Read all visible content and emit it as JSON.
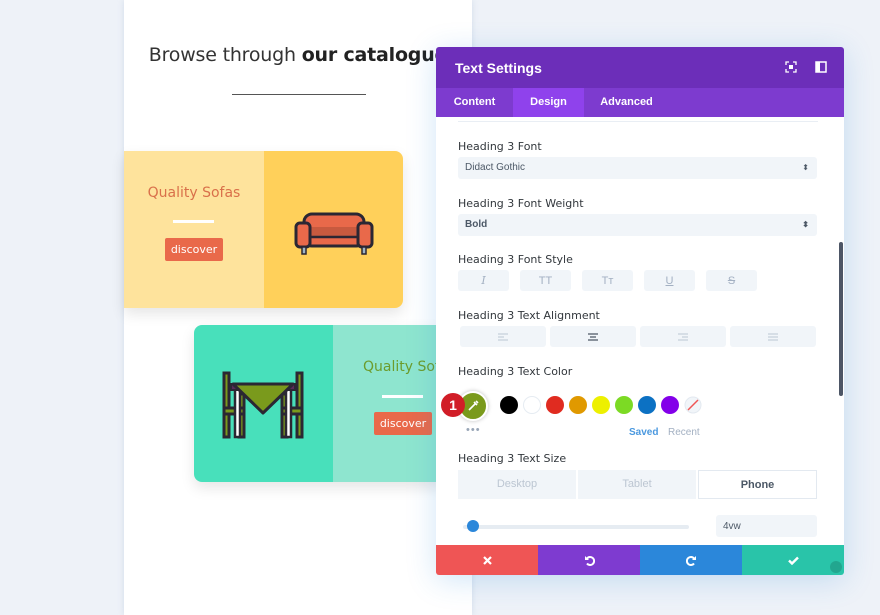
{
  "page": {
    "headline_light": "Browse through ",
    "headline_bold": "our catalogue"
  },
  "cards": [
    {
      "title": "Quality Sofas",
      "button": "discover",
      "icon": "sofa-icon"
    },
    {
      "title": "Quality Sofas",
      "button": "discover",
      "icon": "dining-table-icon"
    }
  ],
  "modal": {
    "title": "Text Settings",
    "header_icons": [
      "fullscreen-icon",
      "snap-sidebar-icon"
    ],
    "tabs": [
      {
        "label": "Content",
        "active": false
      },
      {
        "label": "Design",
        "active": true
      },
      {
        "label": "Advanced",
        "active": false
      }
    ],
    "fields": {
      "font": {
        "label": "Heading 3 Font",
        "value": "Didact Gothic"
      },
      "font_weight": {
        "label": "Heading 3 Font Weight",
        "value": "Bold"
      },
      "font_style": {
        "label": "Heading 3 Font Style",
        "options": [
          "I",
          "TT",
          "Tт",
          "U",
          "S"
        ]
      },
      "alignment": {
        "label": "Heading 3 Text Alignment",
        "options": [
          "left",
          "center",
          "right",
          "justify"
        ],
        "selected": "center"
      },
      "color": {
        "label": "Heading 3 Text Color",
        "current": "#7a9a1c",
        "badge": "1",
        "swatches": [
          "#000000",
          "#ffffff",
          "#e02b20",
          "#e09900",
          "#edf000",
          "#7cda24",
          "#0c71c3",
          "#8300e9"
        ],
        "more": "•••",
        "saved_label": "Saved",
        "recent_label": "Recent"
      },
      "text_size": {
        "label": "Heading 3 Text Size",
        "devices": [
          "Desktop",
          "Tablet",
          "Phone"
        ],
        "active_device": "Phone",
        "value": "4vw",
        "slider_fraction": 0.02
      }
    },
    "footer": [
      "close-icon",
      "undo-icon",
      "redo-icon",
      "check-icon"
    ]
  }
}
